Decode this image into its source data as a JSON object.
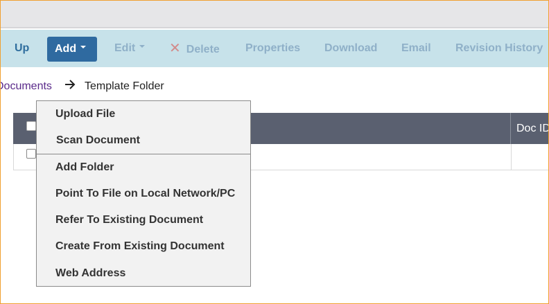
{
  "toolbar": {
    "up_label": "Up",
    "add_label": "Add",
    "edit_label": "Edit",
    "delete_label": "Delete",
    "properties_label": "Properties",
    "download_label": "Download",
    "email_label": "Email",
    "revision_history_label": "Revision History",
    "delete_icon": "close-x-icon",
    "accent_color": "#2f6aa0"
  },
  "breadcrumb": {
    "parent": "Documents",
    "separator_icon": "arrow-right-icon",
    "current": "Template Folder"
  },
  "table": {
    "columns": [
      "Doc ID"
    ]
  },
  "add_menu": {
    "items": [
      "Upload File",
      "Scan Document",
      "Add Folder",
      "Point To File on Local Network/PC",
      "Refer To Existing Document",
      "Create From Existing Document",
      "Web Address"
    ]
  }
}
